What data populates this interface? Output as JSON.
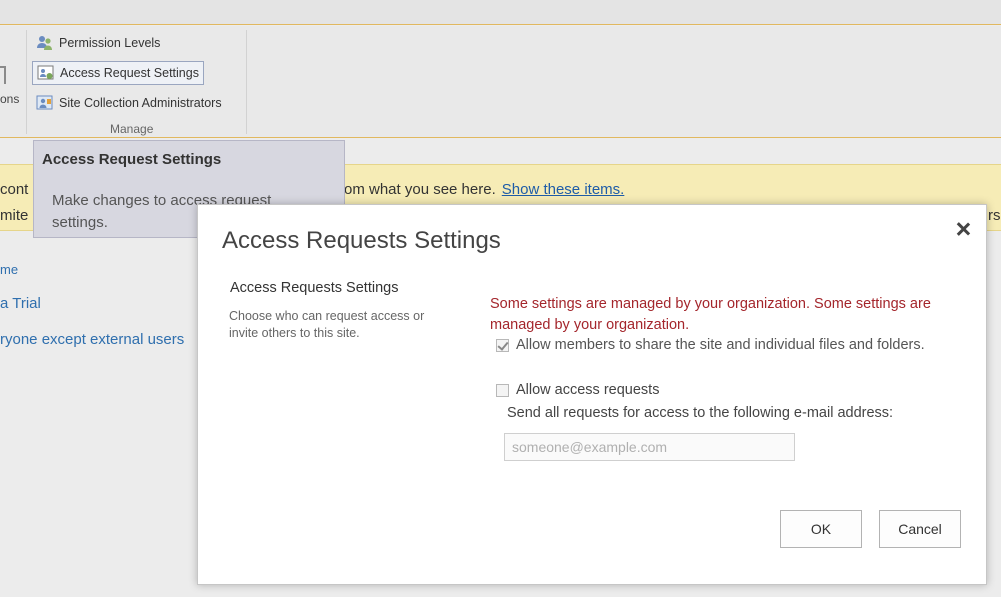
{
  "ribbon": {
    "left_fragment": "ons",
    "items": [
      {
        "label": "Permission Levels",
        "icon": "people-icon"
      },
      {
        "label": "Access Request Settings",
        "icon": "access-request-icon"
      },
      {
        "label": "Site Collection Administrators",
        "icon": "site-admin-icon"
      }
    ],
    "group_label": "Manage"
  },
  "infobar": {
    "line1_left": "cont",
    "line1_right": "om what you see here.",
    "link": "Show these items.",
    "line2_left": "mite",
    "line2_right": "rs."
  },
  "background_links": {
    "home": "me",
    "trial": "a Trial",
    "everyone": "ryone except external users"
  },
  "tooltip": {
    "title": "Access Request Settings",
    "body": "Make changes to access request settings."
  },
  "dialog": {
    "title": "Access Requests Settings",
    "section_title": "Access Requests Settings",
    "section_desc": "Choose who can request access or invite others to this site.",
    "warning": "Some settings are managed by your organization. Some settings are managed by your organization.",
    "allow_sharing_label": "Allow members to share the site and individual files and folders.",
    "allow_requests_label": "Allow access requests",
    "email_label": "Send all requests for access to the following e-mail address:",
    "email_value": "",
    "email_placeholder": "someone@example.com",
    "ok_label": "OK",
    "cancel_label": "Cancel"
  },
  "colors": {
    "warning": "#a4262c",
    "link": "#1e5ca8",
    "infobar": "#f6ecb6",
    "accent_line": "#e1b85f"
  }
}
